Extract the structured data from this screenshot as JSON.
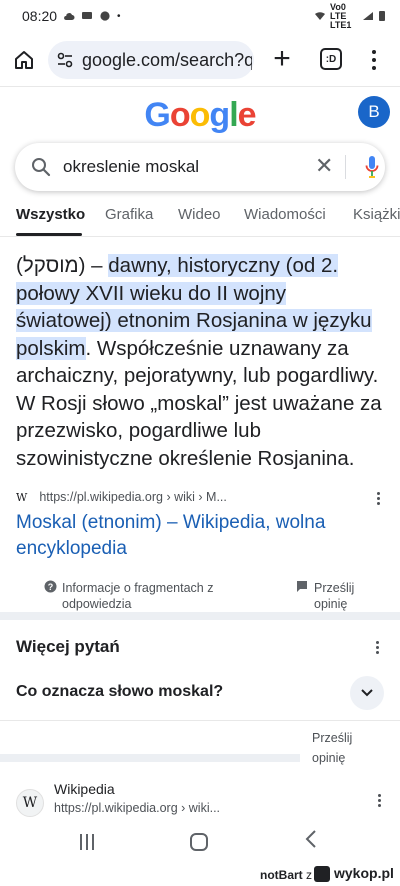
{
  "status_bar": {
    "time": "08:20",
    "battery_text": "Vo0 LTE LTE1"
  },
  "browser": {
    "url": "google.com/search?q=",
    "tabs_label": ":D"
  },
  "google": {
    "logo": [
      "G",
      "o",
      "o",
      "g",
      "l",
      "e"
    ],
    "logo_colors": [
      "#4285F4",
      "#EA4335",
      "#FBBC05",
      "#4285F4",
      "#34A853",
      "#EA4335"
    ],
    "avatar_letter": "B",
    "search_query": "okreslenie moskal"
  },
  "tabs": [
    "Wszystko",
    "Grafika",
    "Wideo",
    "Wiadomości",
    "Książki"
  ],
  "snippet": {
    "prefix": "(מוסקל) – ",
    "highlighted": "dawny, historyczny (od 2. połowy XVII wieku do II wojny światowej) etnonim Rosjanina w języku polskim",
    "rest": ". Współcześnie uznawany za archaiczny, pejoratywny, lub pogardliwy. W Rosji słowo „moskal” jest uważane za przezwisko, pogardliwe lub szowinistyczne określenie Rosjanina.",
    "source_favicon": "W",
    "source_url": "https://pl.wikipedia.org › wiki › M...",
    "result_title": "Moskal (etnonim) – Wikipedia, wolna encyklopedia"
  },
  "feedback": {
    "info_label": "Informacje o fragmentach z odpowiedzia",
    "send_label": "Prześlij opinię"
  },
  "more_questions": {
    "title": "Więcej pytań",
    "question": "Co oznacza słowo moskal?",
    "feedback": "Prześlij opinię"
  },
  "wiki_result": {
    "icon": "W",
    "name": "Wikipedia",
    "url": "https://pl.wikipedia.org › wiki..."
  },
  "watermark": {
    "user": "notBart",
    "sep": "z",
    "site": "wykop.pl"
  },
  "colors": {
    "highlight": "#d3e3fd",
    "link": "#1a5fb4",
    "avatar": "#1a66c9"
  }
}
